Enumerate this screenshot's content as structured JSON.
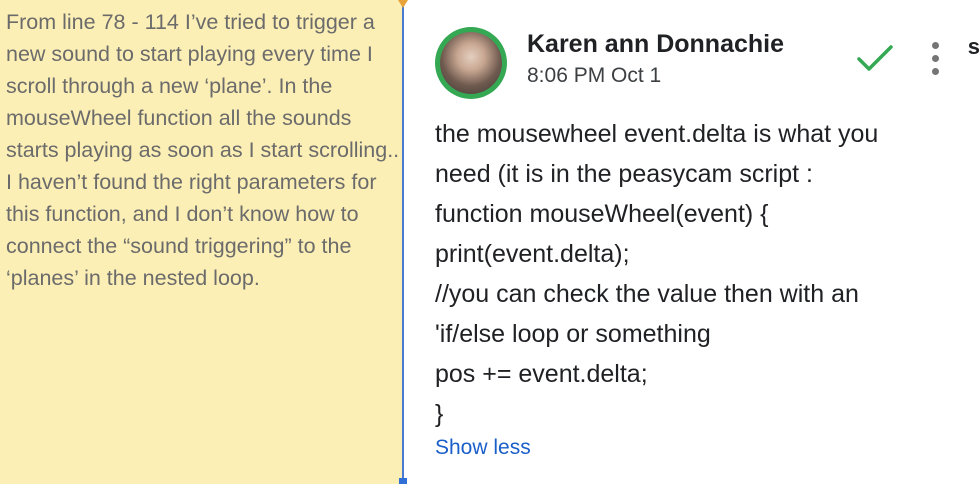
{
  "document": {
    "highlighted_text": "From line 78 - 114 I’ve tried to trigger a new sound to start playing every time I scroll through a new ‘plane’. In the mouseWheel function all the sounds starts playing as soon as I start scrolling.. I haven’t found the right parameters for this function, and I don’t know how to connect the “sound triggering” to the ‘planes’ in the nested loop.",
    "highlight_color": "#fcefb5"
  },
  "comment": {
    "author": "Karen ann Donnachie",
    "timestamp": "8:06 PM Oct 1",
    "body_lines": [
      "the mousewheel event.delta is what you",
      "need (it is in the peasycam script :",
      "function mouseWheel(event) {",
      "print(event.delta);",
      "//you can check the value then with an",
      "'if/else loop or something",
      "pos += event.delta;",
      "}"
    ],
    "show_less_label": "Show less",
    "resolve_icon": "checkmark-icon",
    "more_icon": "more-vert-icon",
    "accent_color": "#34a853",
    "link_color": "#1a5fc9"
  },
  "edge_glyph": "s"
}
